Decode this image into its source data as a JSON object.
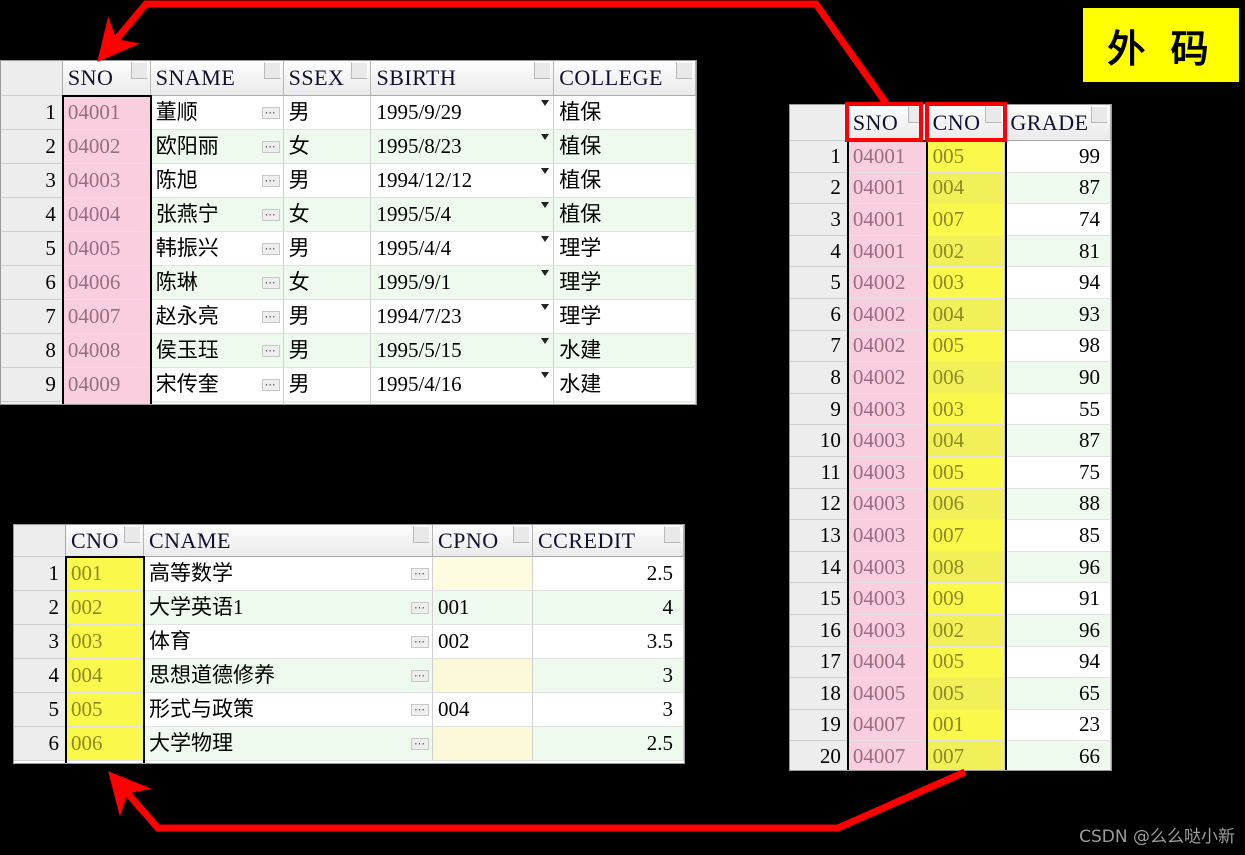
{
  "annotation": {
    "label": "外 码",
    "label_bg": "#ffff00",
    "highlight_color": "#ff0000",
    "watermark": "CSDN @么么哒小新"
  },
  "student_table": {
    "name": "student-table",
    "columns": [
      "SNO",
      "SNAME",
      "SSEX",
      "SBIRTH",
      "COLLEGE"
    ],
    "rows": [
      {
        "n": "1",
        "SNO": "04001",
        "SNAME": "董顺",
        "SSEX": "男",
        "SBIRTH": "1995/9/29",
        "COLLEGE": "植保"
      },
      {
        "n": "2",
        "SNO": "04002",
        "SNAME": "欧阳丽",
        "SSEX": "女",
        "SBIRTH": "1995/8/23",
        "COLLEGE": "植保"
      },
      {
        "n": "3",
        "SNO": "04003",
        "SNAME": "陈旭",
        "SSEX": "男",
        "SBIRTH": "1994/12/12",
        "COLLEGE": "植保"
      },
      {
        "n": "4",
        "SNO": "04004",
        "SNAME": "张燕宁",
        "SSEX": "女",
        "SBIRTH": "1995/5/4",
        "COLLEGE": "植保"
      },
      {
        "n": "5",
        "SNO": "04005",
        "SNAME": "韩振兴",
        "SSEX": "男",
        "SBIRTH": "1995/4/4",
        "COLLEGE": "理学"
      },
      {
        "n": "6",
        "SNO": "04006",
        "SNAME": "陈琳",
        "SSEX": "女",
        "SBIRTH": "1995/9/1",
        "COLLEGE": "理学"
      },
      {
        "n": "7",
        "SNO": "04007",
        "SNAME": "赵永亮",
        "SSEX": "男",
        "SBIRTH": "1994/7/23",
        "COLLEGE": "理学"
      },
      {
        "n": "8",
        "SNO": "04008",
        "SNAME": "侯玉珏",
        "SSEX": "男",
        "SBIRTH": "1995/5/15",
        "COLLEGE": "水建"
      },
      {
        "n": "9",
        "SNO": "04009",
        "SNAME": "宋传奎",
        "SSEX": "男",
        "SBIRTH": "1995/4/16",
        "COLLEGE": "水建"
      }
    ]
  },
  "course_table": {
    "name": "course-table",
    "columns": [
      "CNO",
      "CNAME",
      "CPNO",
      "CCREDIT"
    ],
    "rows": [
      {
        "n": "1",
        "CNO": "001",
        "CNAME": "高等数学",
        "CPNO": "",
        "CCREDIT": "2.5"
      },
      {
        "n": "2",
        "CNO": "002",
        "CNAME": "大学英语1",
        "CPNO": "001",
        "CCREDIT": "4"
      },
      {
        "n": "3",
        "CNO": "003",
        "CNAME": "体育",
        "CPNO": "002",
        "CCREDIT": "3.5"
      },
      {
        "n": "4",
        "CNO": "004",
        "CNAME": "思想道德修养",
        "CPNO": "",
        "CCREDIT": "3"
      },
      {
        "n": "5",
        "CNO": "005",
        "CNAME": "形式与政策",
        "CPNO": "004",
        "CCREDIT": "3"
      },
      {
        "n": "6",
        "CNO": "006",
        "CNAME": "大学物理",
        "CPNO": "",
        "CCREDIT": "2.5"
      }
    ]
  },
  "sc_table": {
    "name": "sc-table",
    "columns": [
      "SNO",
      "CNO",
      "GRADE"
    ],
    "highlighted_columns": [
      "SNO",
      "CNO"
    ],
    "rows": [
      {
        "n": "1",
        "SNO": "04001",
        "CNO": "005",
        "GRADE": "99"
      },
      {
        "n": "2",
        "SNO": "04001",
        "CNO": "004",
        "GRADE": "87"
      },
      {
        "n": "3",
        "SNO": "04001",
        "CNO": "007",
        "GRADE": "74"
      },
      {
        "n": "4",
        "SNO": "04001",
        "CNO": "002",
        "GRADE": "81"
      },
      {
        "n": "5",
        "SNO": "04002",
        "CNO": "003",
        "GRADE": "94"
      },
      {
        "n": "6",
        "SNO": "04002",
        "CNO": "004",
        "GRADE": "93"
      },
      {
        "n": "7",
        "SNO": "04002",
        "CNO": "005",
        "GRADE": "98"
      },
      {
        "n": "8",
        "SNO": "04002",
        "CNO": "006",
        "GRADE": "90"
      },
      {
        "n": "9",
        "SNO": "04003",
        "CNO": "003",
        "GRADE": "55"
      },
      {
        "n": "10",
        "SNO": "04003",
        "CNO": "004",
        "GRADE": "87"
      },
      {
        "n": "11",
        "SNO": "04003",
        "CNO": "005",
        "GRADE": "75"
      },
      {
        "n": "12",
        "SNO": "04003",
        "CNO": "006",
        "GRADE": "88"
      },
      {
        "n": "13",
        "SNO": "04003",
        "CNO": "007",
        "GRADE": "85"
      },
      {
        "n": "14",
        "SNO": "04003",
        "CNO": "008",
        "GRADE": "96"
      },
      {
        "n": "15",
        "SNO": "04003",
        "CNO": "009",
        "GRADE": "91"
      },
      {
        "n": "16",
        "SNO": "04003",
        "CNO": "002",
        "GRADE": "96"
      },
      {
        "n": "17",
        "SNO": "04004",
        "CNO": "005",
        "GRADE": "94"
      },
      {
        "n": "18",
        "SNO": "04005",
        "CNO": "005",
        "GRADE": "65"
      },
      {
        "n": "19",
        "SNO": "04007",
        "CNO": "001",
        "GRADE": "23"
      },
      {
        "n": "20",
        "SNO": "04007",
        "CNO": "007",
        "GRADE": "66"
      }
    ]
  }
}
